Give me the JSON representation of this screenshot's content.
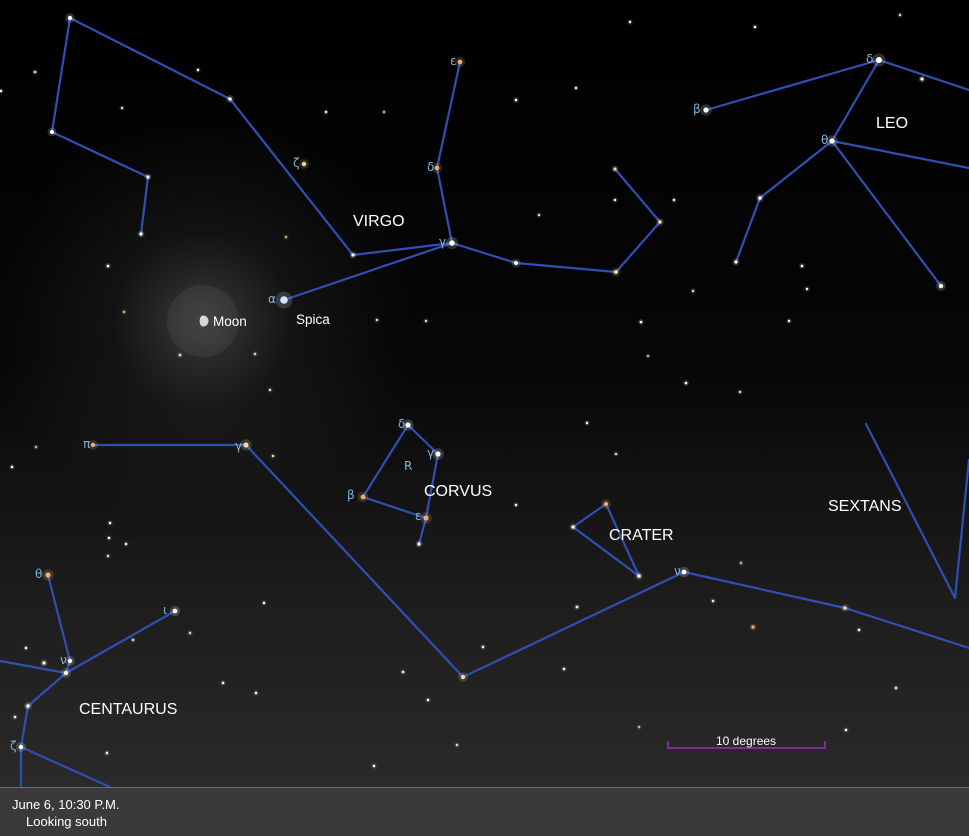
{
  "footer": {
    "date_time": "June 6, 10:30 P.M.",
    "view": "Looking south"
  },
  "scale_bar": {
    "label": "10 degrees",
    "color": "#9b2fbf"
  },
  "colors": {
    "line": "#2f4fb5",
    "greek": "#7fb4d8",
    "label": "#ffffff"
  },
  "constellations": {
    "virgo": "VIRGO",
    "leo": "LEO",
    "corvus": "CORVUS",
    "crater": "CRATER",
    "sextans": "SEXTANS",
    "centaurus": "CENTAURUS"
  },
  "bodies": {
    "moon": "Moon",
    "spica": "Spica",
    "moon_icon": "moon-icon"
  },
  "greek": {
    "virgo_epsilon": "ε",
    "virgo_delta": "δ",
    "virgo_gamma": "γ",
    "virgo_zeta": "ζ",
    "virgo_alpha": "α",
    "leo_delta": "δ",
    "leo_beta": "β",
    "leo_theta": "θ",
    "corvus_delta": "δ",
    "corvus_gamma": "γ",
    "corvus_beta": "β",
    "corvus_epsilon": "ε",
    "corvus_R": "R",
    "hydra_pi": "π",
    "hydra_gamma": "γ",
    "hydra_nu": "ν",
    "cen_theta": "θ",
    "cen_nu": "ν",
    "cen_iota": "ι",
    "cen_zeta": "ζ"
  }
}
